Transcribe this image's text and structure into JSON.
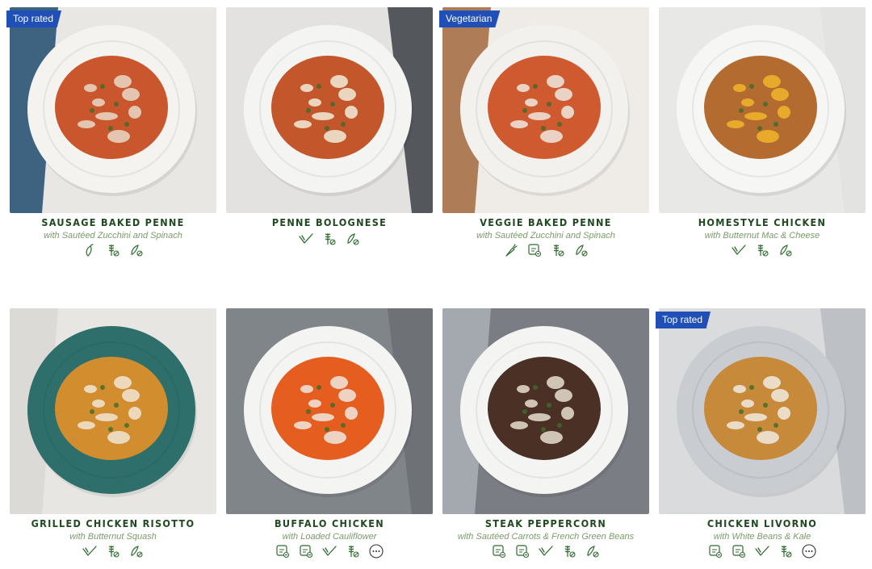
{
  "meals": [
    {
      "badge": "Top rated",
      "title": "SAUSAGE BAKED PENNE",
      "subtitle": "with Sautéed Zucchini and Spinach",
      "icons": [
        "spicy-icon",
        "wheat-icon",
        "dairy-icon"
      ],
      "photo": {
        "bg": "#e9e7e3",
        "plate": "#f5f3ef",
        "food": "#c9562d",
        "accent": "#e9d8c8",
        "cloth": "#1e4b6e"
      }
    },
    {
      "badge": "",
      "title": "PENNE BOLOGNESE",
      "subtitle": "",
      "icons": [
        "check-icon",
        "wheat-icon",
        "dairy-icon"
      ],
      "photo": {
        "bg": "#e3e2e0",
        "plate": "#f4f4f2",
        "food": "#c4562b",
        "accent": "#f1ecd9",
        "cloth": "#3b3f45"
      }
    },
    {
      "badge": "Vegetarian",
      "title": "VEGGIE BAKED PENNE",
      "subtitle": "with Sautéed Zucchini and Spinach",
      "icons": [
        "carrot-icon",
        "calorie-icon",
        "wheat-icon",
        "dairy-icon"
      ],
      "photo": {
        "bg": "#efece7",
        "plate": "#f3f1ee",
        "food": "#cf5a2f",
        "accent": "#efe7de",
        "cloth": "#a26a3e"
      }
    },
    {
      "badge": "",
      "title": "HOMESTYLE CHICKEN",
      "subtitle": "with Butternut Mac & Cheese",
      "icons": [
        "check-icon",
        "wheat-icon",
        "dairy-icon"
      ],
      "photo": {
        "bg": "#e8e8e7",
        "plate": "#f6f6f5",
        "food": "#b46b2f",
        "accent": "#f2b52b",
        "cloth": "#e2e2e1"
      }
    },
    {
      "badge": "",
      "title": "GRILLED CHICKEN RISOTTO",
      "subtitle": "with Butternut Squash",
      "icons": [
        "check-icon",
        "wheat-icon",
        "dairy-icon"
      ],
      "photo": {
        "bg": "#e7e6e3",
        "plate": "#2f6f6b",
        "food": "#d18d2e",
        "accent": "#f1e6d5",
        "cloth": "#d9d7d3"
      }
    },
    {
      "badge": "",
      "title": "BUFFALO CHICKEN",
      "subtitle": "with Loaded Cauliflower",
      "icons": [
        "calorie-icon",
        "calorie-icon",
        "check-icon",
        "wheat-icon",
        "more-icon"
      ],
      "photo": {
        "bg": "#80858a",
        "plate": "#f4f4f2",
        "food": "#e65d20",
        "accent": "#eee8df",
        "cloth": "#6b6f73"
      }
    },
    {
      "badge": "",
      "title": "STEAK PEPPERCORN",
      "subtitle": "with Sautéed Carrots & French Green Beans",
      "icons": [
        "calorie-icon",
        "calorie-icon",
        "check-icon",
        "wheat-icon",
        "dairy-icon"
      ],
      "photo": {
        "bg": "#7a7e84",
        "plate": "#f4f4f2",
        "food": "#4a3025",
        "accent": "#e8ded1",
        "cloth": "#aab0b6"
      }
    },
    {
      "badge": "Top rated",
      "title": "CHICKEN LIVORNO",
      "subtitle": "with White Beans & Kale",
      "icons": [
        "calorie-icon",
        "calorie-icon",
        "check-icon",
        "wheat-icon",
        "more-icon"
      ],
      "photo": {
        "bg": "#d9dbdd",
        "plate": "#c9cdd1",
        "food": "#c7893a",
        "accent": "#f0ebe0",
        "cloth": "#b7bcc1"
      }
    }
  ]
}
